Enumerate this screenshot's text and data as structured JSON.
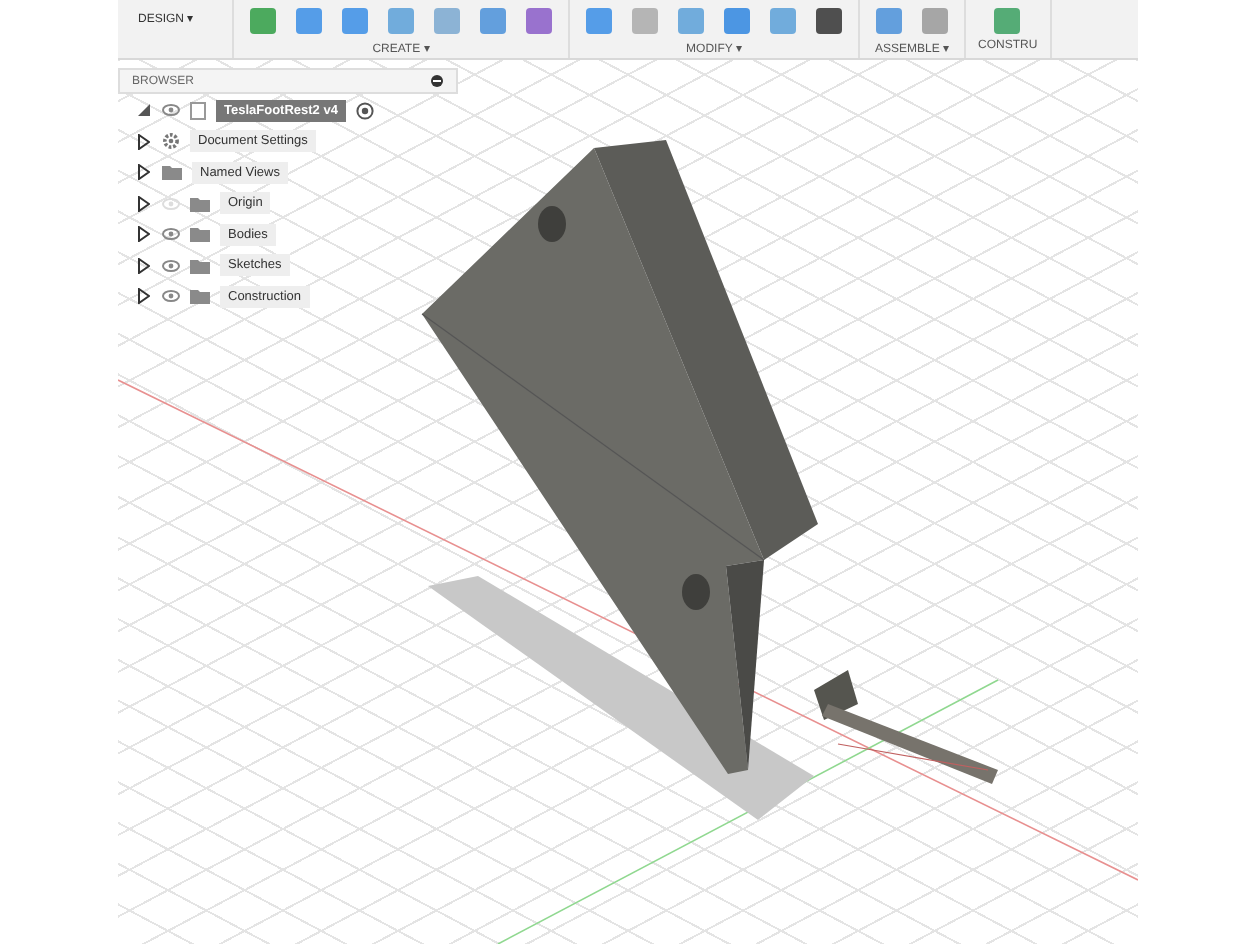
{
  "toolbar": {
    "workspace": "DESIGN",
    "workspace_caret": "▾",
    "groups": [
      {
        "label": "CREATE",
        "caret": "▾"
      },
      {
        "label": "MODIFY",
        "caret": "▾"
      },
      {
        "label": "ASSEMBLE",
        "caret": "▾"
      },
      {
        "label": "CONSTRU"
      }
    ]
  },
  "browser": {
    "title": "BROWSER",
    "root": {
      "label": "TeslaFootRest2 v4",
      "selected": true
    },
    "items": [
      {
        "label": "Document Settings",
        "kind": "settings",
        "eye": false
      },
      {
        "label": "Named Views",
        "kind": "folder",
        "eye": false
      },
      {
        "label": "Origin",
        "kind": "folder",
        "eye": true,
        "visible": false
      },
      {
        "label": "Bodies",
        "kind": "folder",
        "eye": true,
        "visible": true
      },
      {
        "label": "Sketches",
        "kind": "folder",
        "eye": true,
        "visible": true
      },
      {
        "label": "Construction",
        "kind": "folder",
        "eye": true,
        "visible": true
      }
    ]
  }
}
